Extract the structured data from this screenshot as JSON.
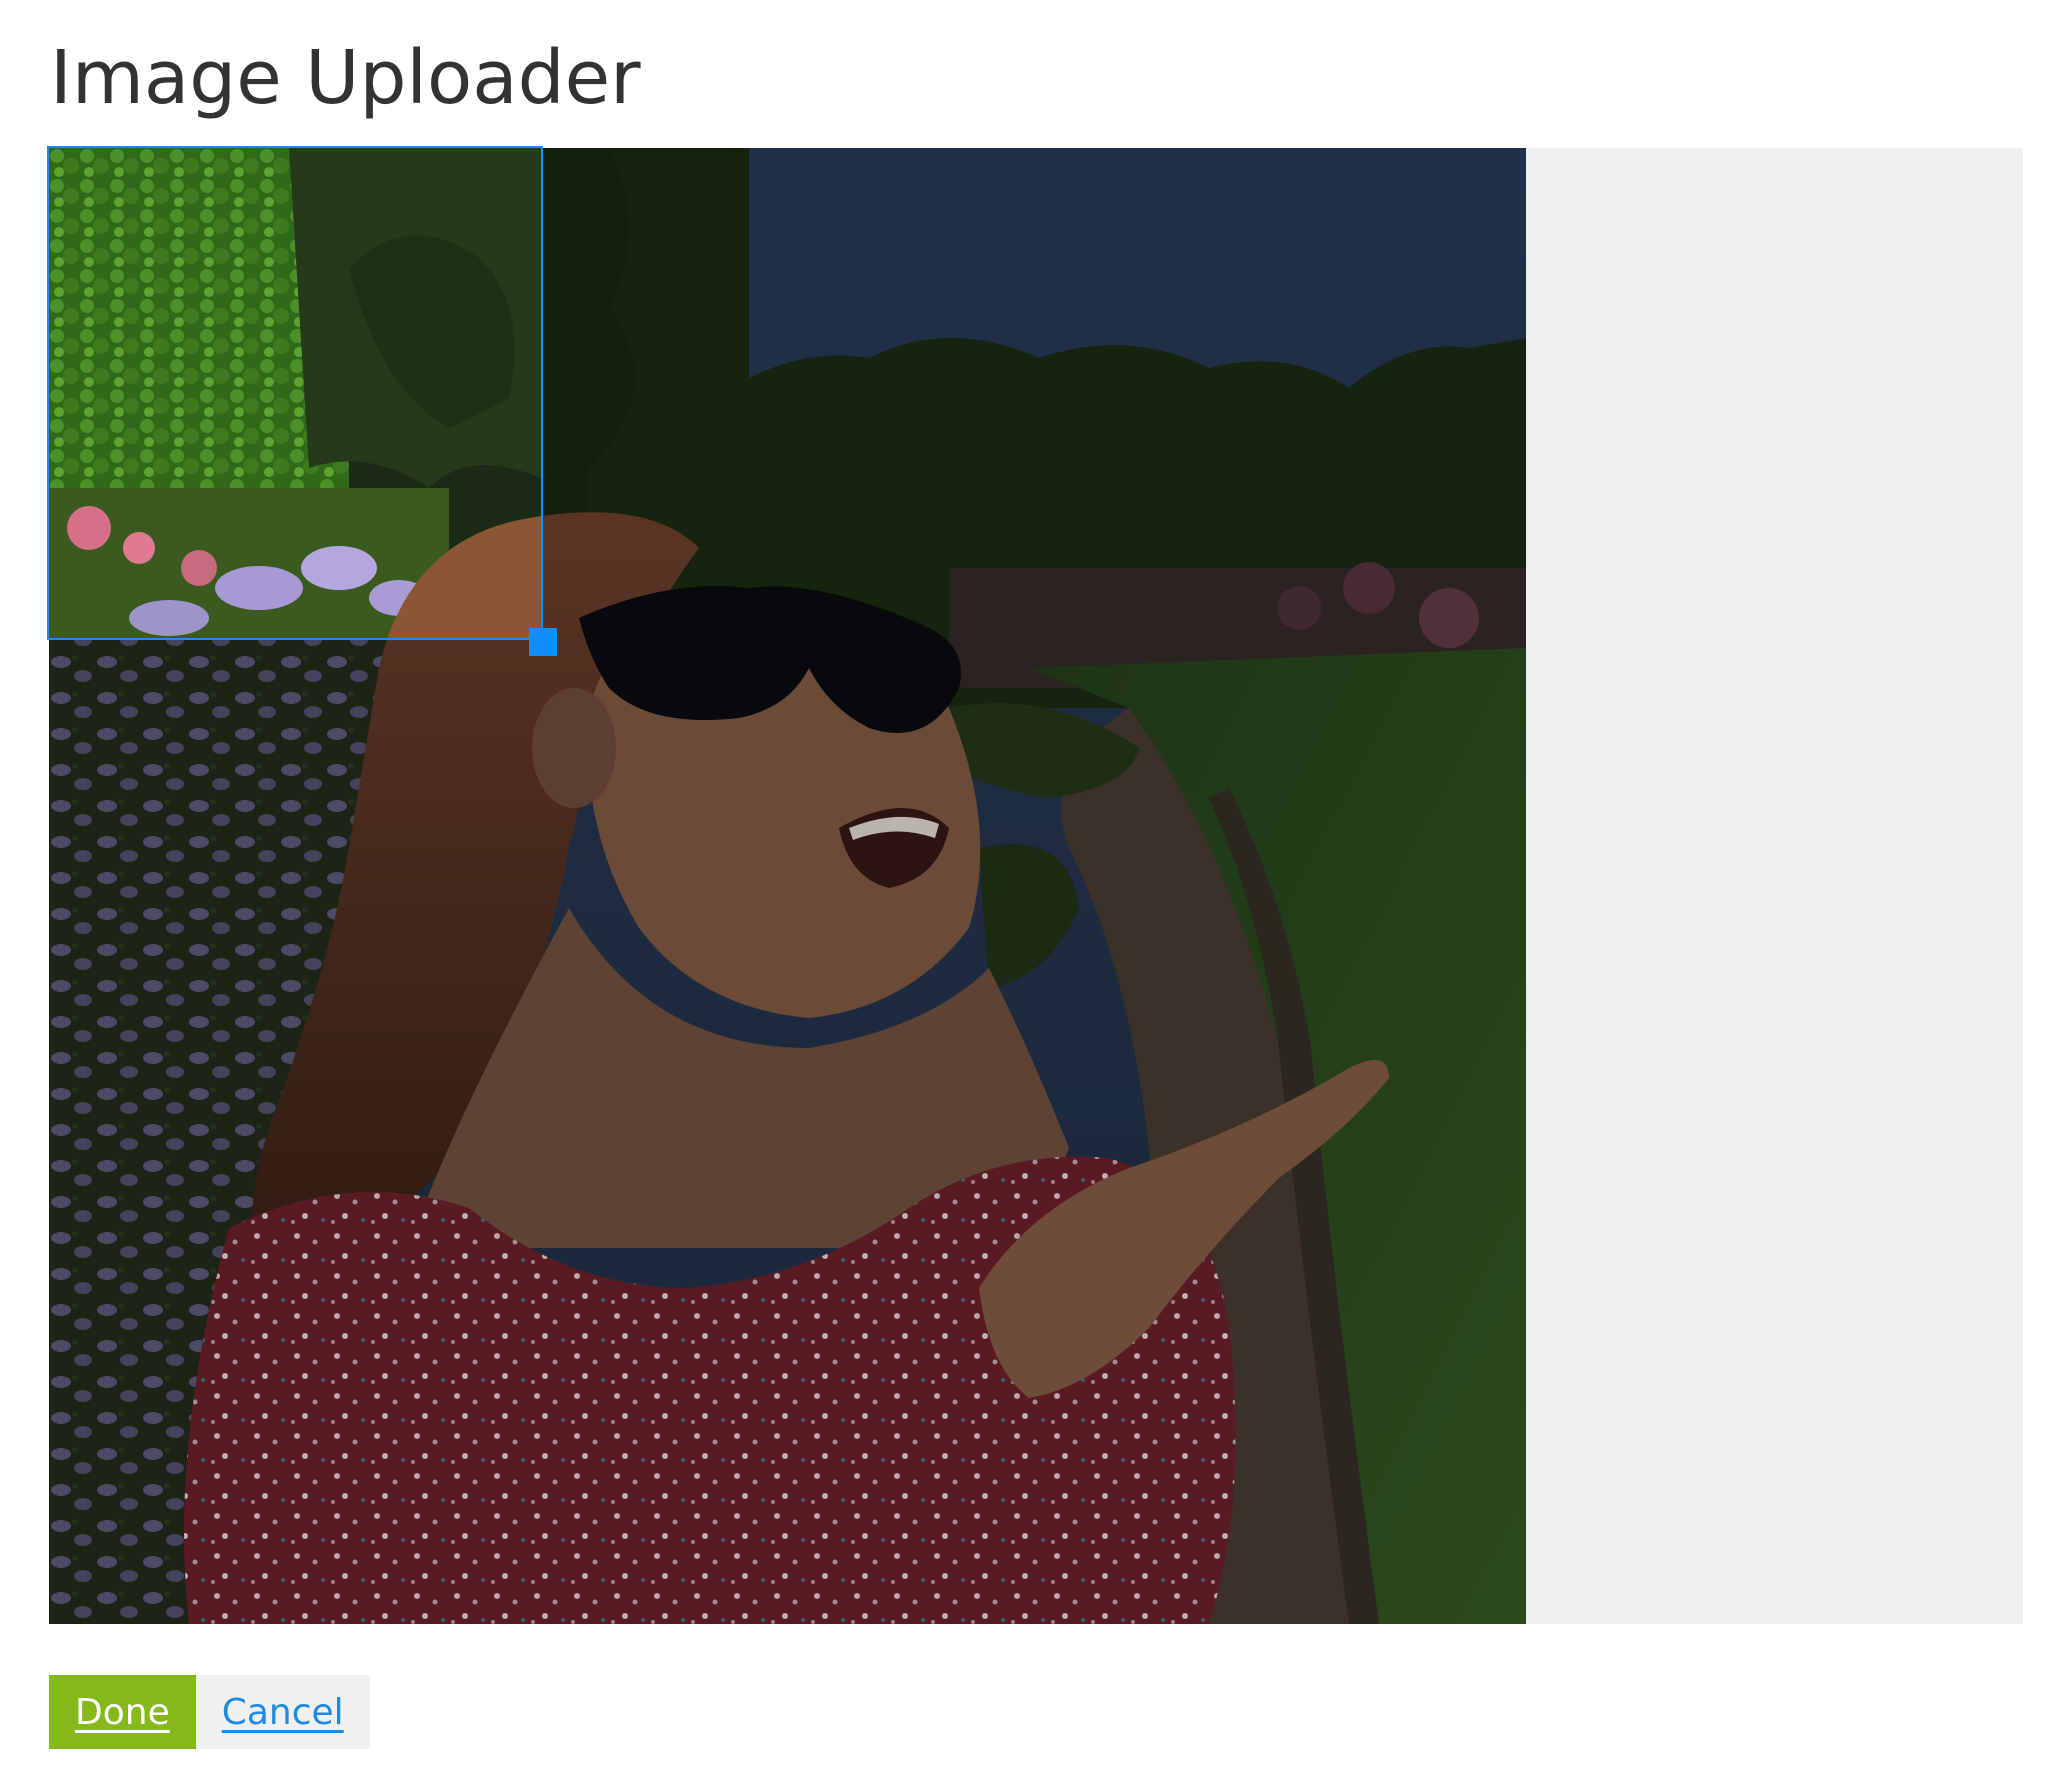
{
  "page": {
    "title": "Image Uploader"
  },
  "cropper": {
    "image_alt": "Woman in sunglasses and red floral dress looking up in a garden",
    "selection_label": "Crop selection",
    "handle_label": "Resize handle"
  },
  "actions": {
    "done_label": "Done",
    "cancel_label": "Cancel"
  },
  "colors": {
    "accent_blue": "#1a8cff",
    "done_green": "#85b81a",
    "cancel_bg": "#f0f0f0",
    "cancel_text": "#1d8be0",
    "stage_bg": "#efefef"
  }
}
